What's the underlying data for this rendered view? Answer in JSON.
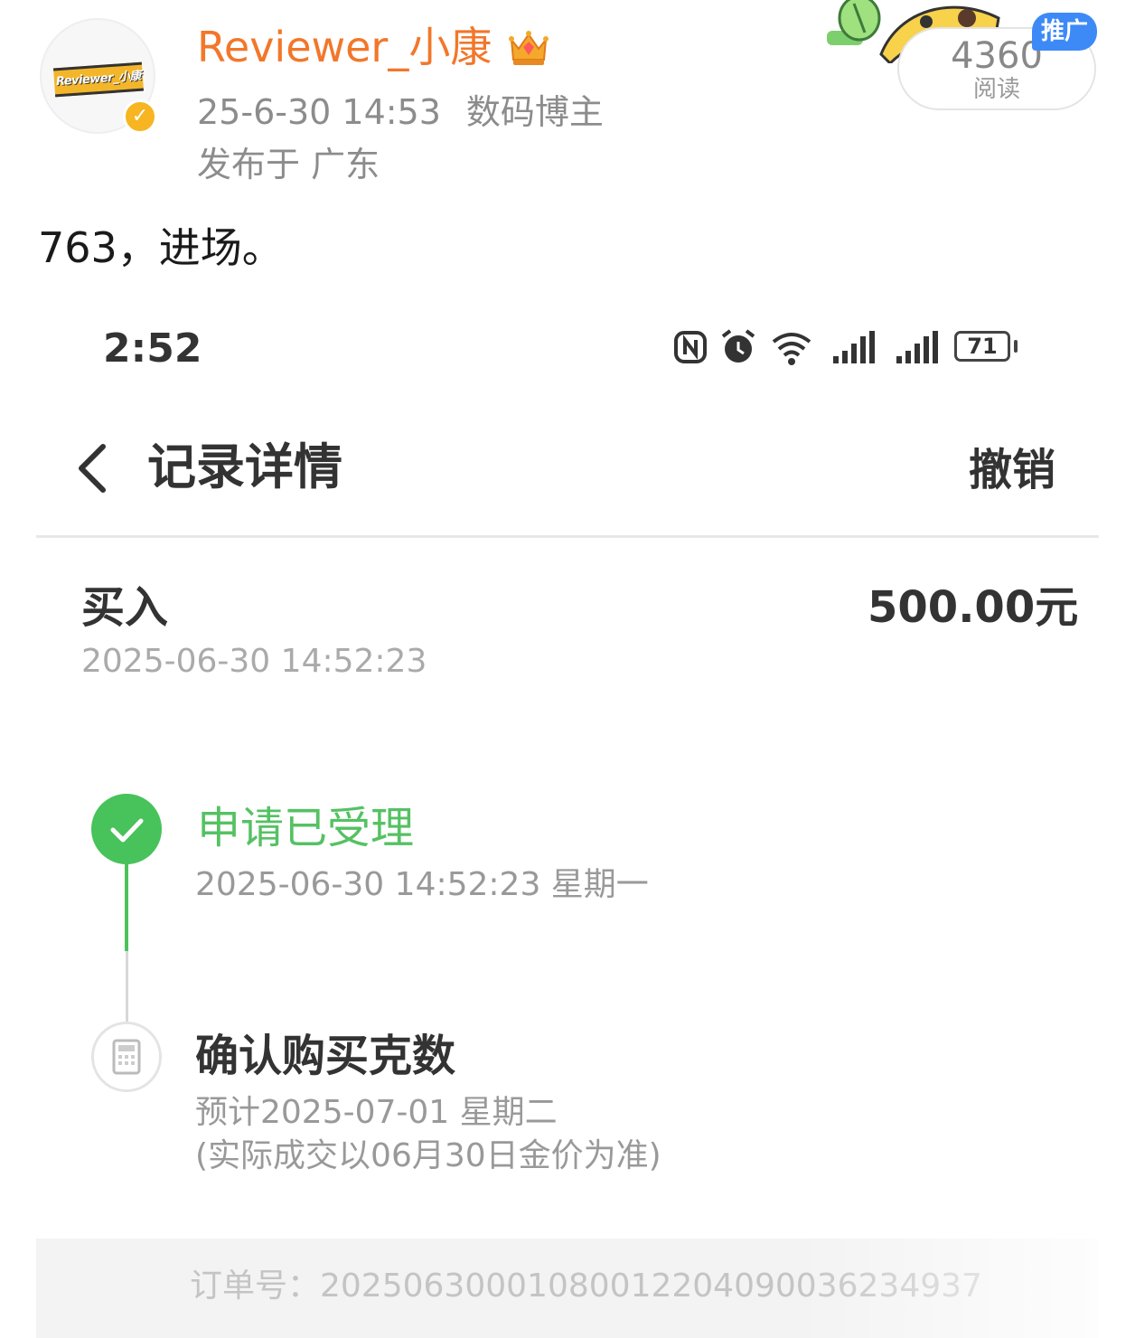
{
  "post": {
    "avatar_text": "Reviewer_小康",
    "username": "Reviewer_小康",
    "date": "25-6-30 14:53",
    "tag": "数码博主",
    "location": "发布于 广东",
    "text": "763，进场。",
    "read_count": "4360",
    "read_label": "阅读",
    "promo_label": "推广"
  },
  "phone": {
    "status_time": "2:52",
    "battery": "71",
    "nav_title": "记录详情",
    "nav_action": "撤销",
    "tx_type": "买入",
    "tx_amount": "500.00元",
    "tx_time": "2025-06-30 14:52:23",
    "steps": [
      {
        "title": "申请已受理",
        "time": "2025-06-30 14:52:23 星期一"
      },
      {
        "title": "确认购买克数",
        "sub1": "预计2025-07-01 星期二",
        "sub2": "(实际成交以06月30日金价为准)"
      }
    ],
    "order": "订单号：20250630001080012204090036234937"
  },
  "colors": {
    "username": "#f2772a",
    "success_green": "#48c25a",
    "promo_blue": "#3d8af7"
  }
}
